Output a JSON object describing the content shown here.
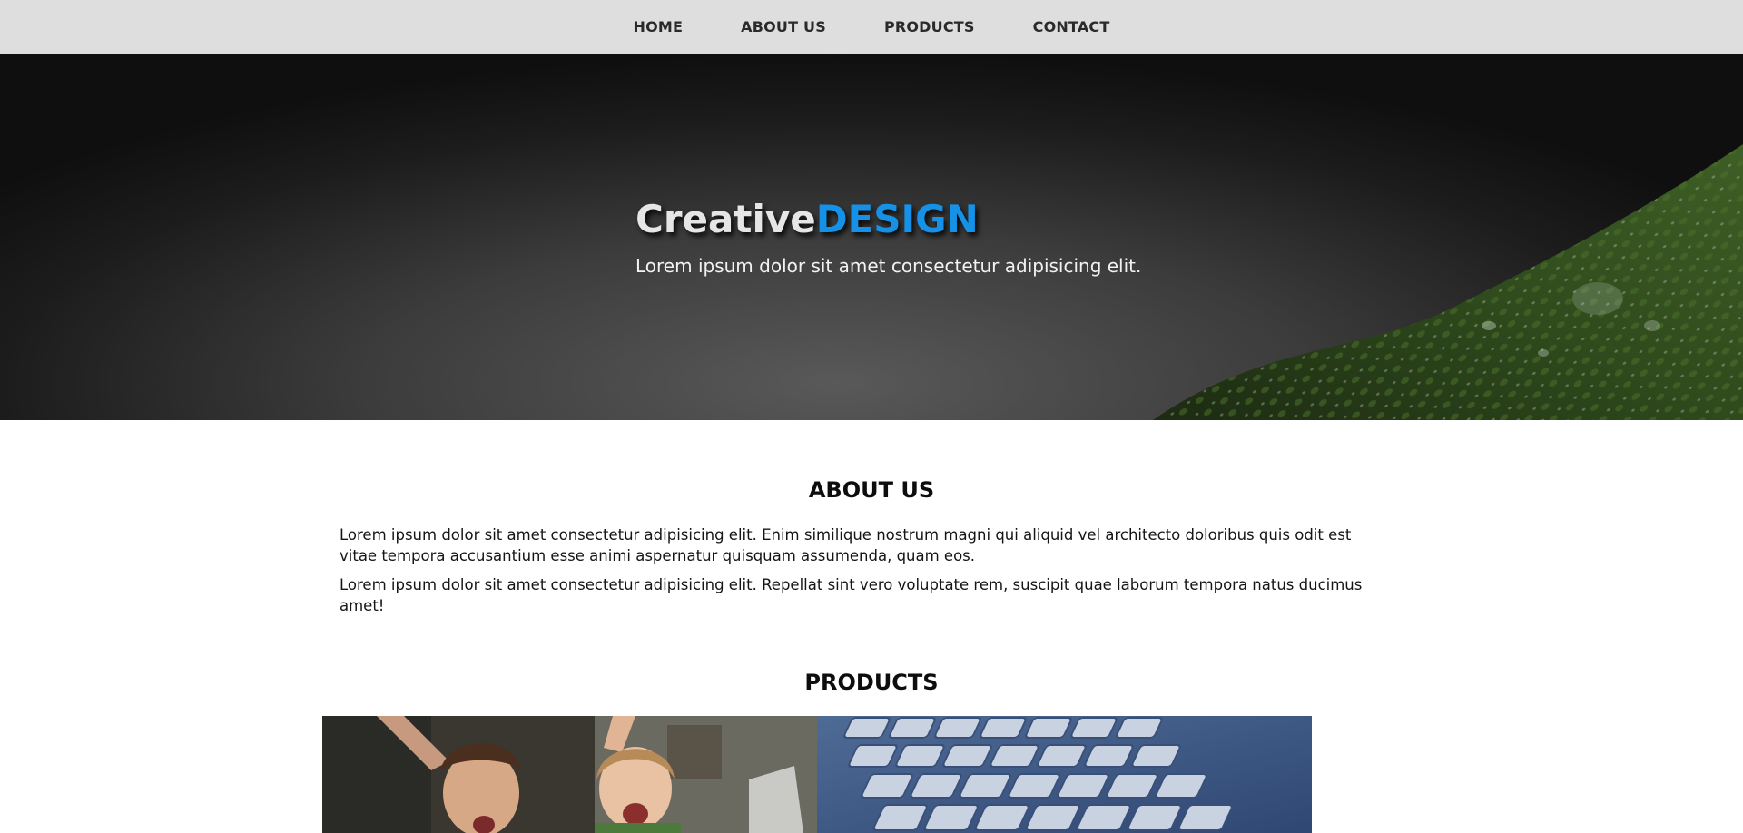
{
  "nav": {
    "items": [
      {
        "label": "HOME"
      },
      {
        "label": "ABOUT US"
      },
      {
        "label": "PRODUCTS"
      },
      {
        "label": "CONTACT"
      }
    ]
  },
  "hero": {
    "title_part1": "Creative",
    "title_part2": "DESIGN",
    "subtitle": "Lorem ipsum dolor sit amet consectetur adipisicing elit.",
    "accent_color": "#1592e8"
  },
  "about": {
    "title": "ABOUT US",
    "paragraphs": [
      "Lorem ipsum dolor sit amet consectetur adipisicing elit. Enim similique nostrum magni qui aliquid vel architecto doloribus quis odit est vitae tempora accusantium esse animi aspernatur quisquam assumenda, quam eos.",
      "Lorem ipsum dolor sit amet consectetur adipisicing elit. Repellat sint vero voluptate rem, suscipit quae laborum tempora natus ducimus amet!"
    ]
  },
  "products": {
    "title": "PRODUCTS"
  }
}
